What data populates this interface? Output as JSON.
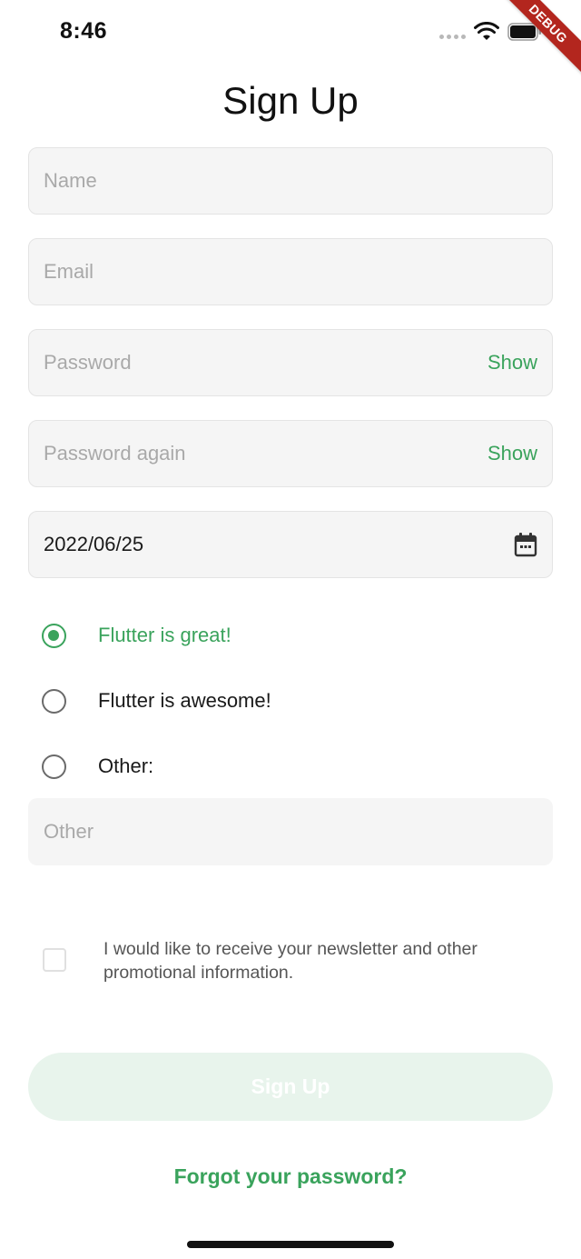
{
  "status_bar": {
    "time": "8:46"
  },
  "debug_banner": "DEBUG",
  "header": {
    "title": "Sign Up",
    "theme_icon": "moon-icon"
  },
  "form": {
    "name": {
      "placeholder": "Name",
      "value": ""
    },
    "email": {
      "placeholder": "Email",
      "value": ""
    },
    "password": {
      "placeholder": "Password",
      "value": "",
      "toggle_label": "Show"
    },
    "password_again": {
      "placeholder": "Password again",
      "value": "",
      "toggle_label": "Show"
    },
    "date": {
      "value": "2022/06/25",
      "icon": "calendar-icon"
    },
    "radio_options": [
      {
        "label": "Flutter is great!",
        "selected": true
      },
      {
        "label": "Flutter is awesome!",
        "selected": false
      },
      {
        "label": "Other:",
        "selected": false
      }
    ],
    "other": {
      "placeholder": "Other",
      "value": ""
    },
    "newsletter": {
      "label": "I would like to receive your newsletter and other promotional information.",
      "checked": false
    },
    "submit_label": "Sign Up",
    "forgot_label": "Forgot your password?"
  },
  "colors": {
    "accent": "#3aa35c",
    "field_bg": "#f5f5f5",
    "button_disabled_bg": "#e8f4ec"
  }
}
